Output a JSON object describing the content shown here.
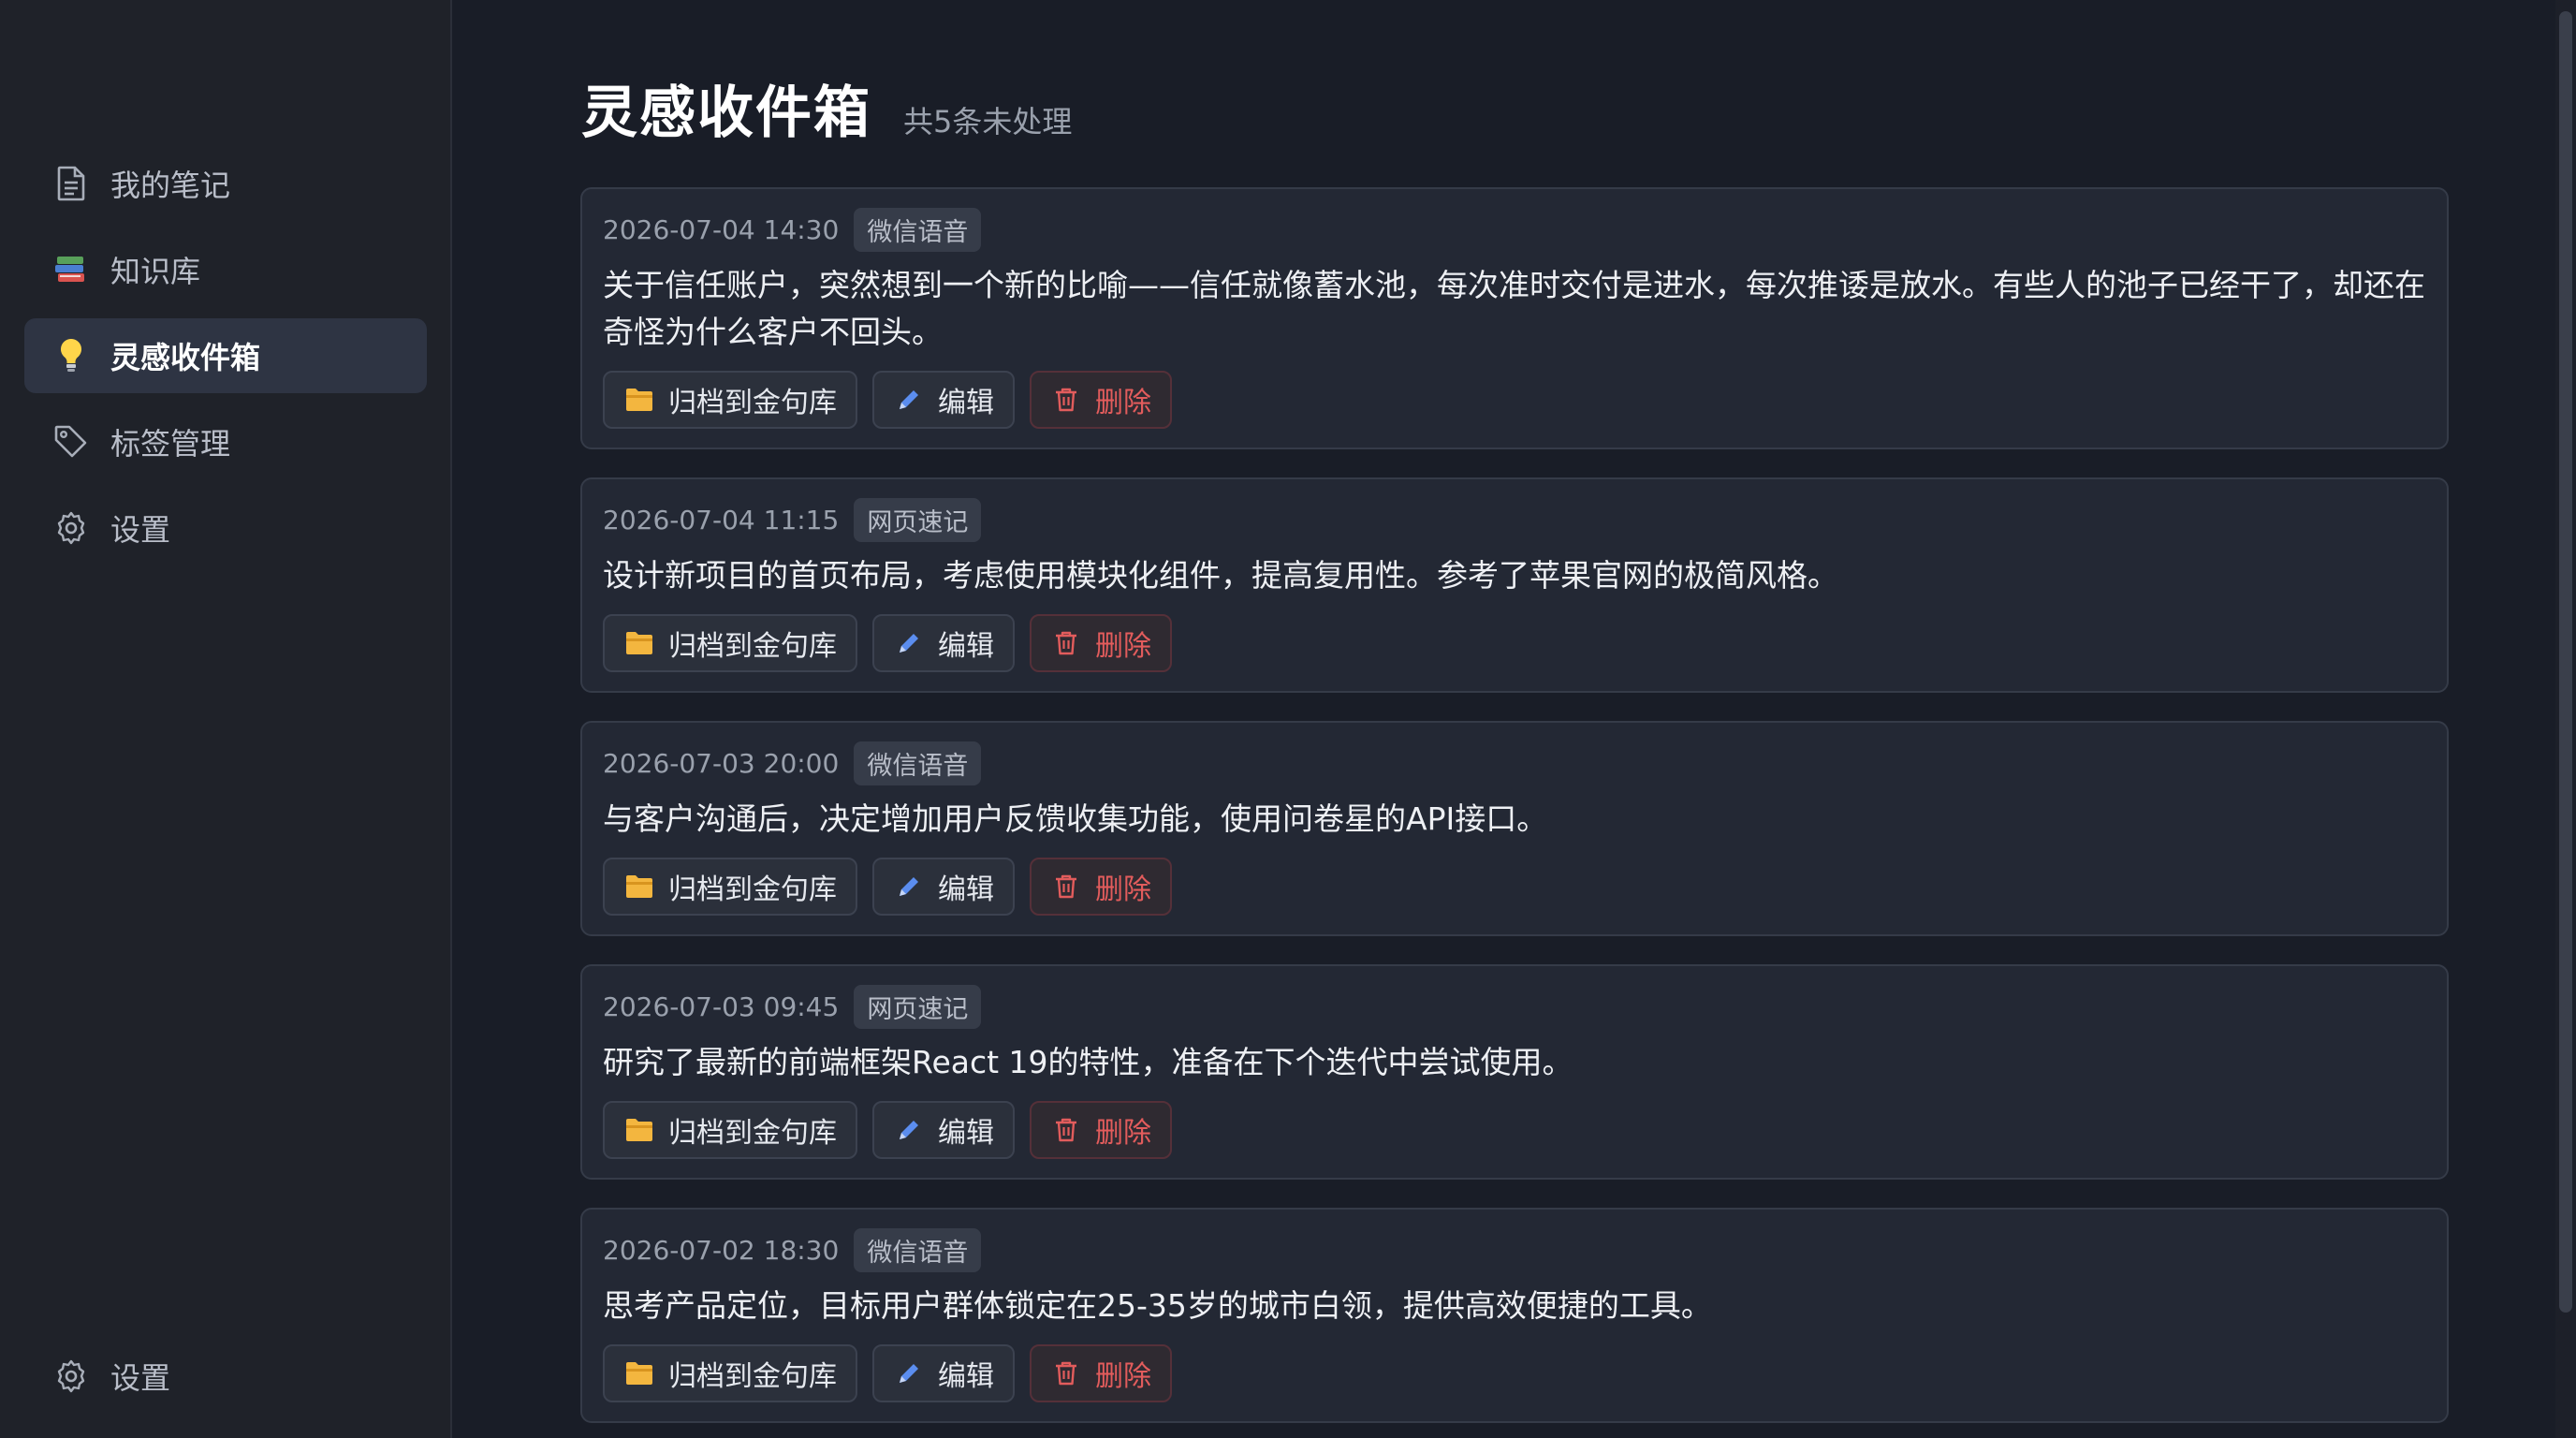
{
  "sidebar": {
    "items": [
      {
        "label": "我的笔记",
        "icon": "document-icon"
      },
      {
        "label": "知识库",
        "icon": "books-icon"
      },
      {
        "label": "灵感收件箱",
        "icon": "lightbulb-icon",
        "active": true
      },
      {
        "label": "标签管理",
        "icon": "tag-icon"
      },
      {
        "label": "设置",
        "icon": "gear-icon"
      }
    ],
    "bottom": {
      "label": "设置",
      "icon": "gear-icon"
    }
  },
  "header": {
    "title": "灵感收件箱",
    "count": "共5条未处理"
  },
  "actions": {
    "archive": "归档到金句库",
    "edit": "编辑",
    "delete": "删除"
  },
  "cards": [
    {
      "time": "2026-07-04 14:30",
      "tag": "微信语音",
      "content": "关于信任账户，突然想到一个新的比喻——信任就像蓄水池，每次准时交付是进水，每次推诿是放水。有些人的池子已经干了，却还在奇怪为什么客户不回头。"
    },
    {
      "time": "2026-07-04 11:15",
      "tag": "网页速记",
      "content": "设计新项目的首页布局，考虑使用模块化组件，提高复用性。参考了苹果官网的极简风格。"
    },
    {
      "time": "2026-07-03 20:00",
      "tag": "微信语音",
      "content": "与客户沟通后，决定增加用户反馈收集功能，使用问卷星的API接口。"
    },
    {
      "time": "2026-07-03 09:45",
      "tag": "网页速记",
      "content": "研究了最新的前端框架React 19的特性，准备在下个迭代中尝试使用。"
    },
    {
      "time": "2026-07-02 18:30",
      "tag": "微信语音",
      "content": "思考产品定位，目标用户群体锁定在25-35岁的城市白领，提供高效便捷的工具。"
    }
  ],
  "colors": {
    "accent_folder": "#f3b63f",
    "edit_pencil": "#5b8def",
    "delete_red": "#e25c5c"
  }
}
